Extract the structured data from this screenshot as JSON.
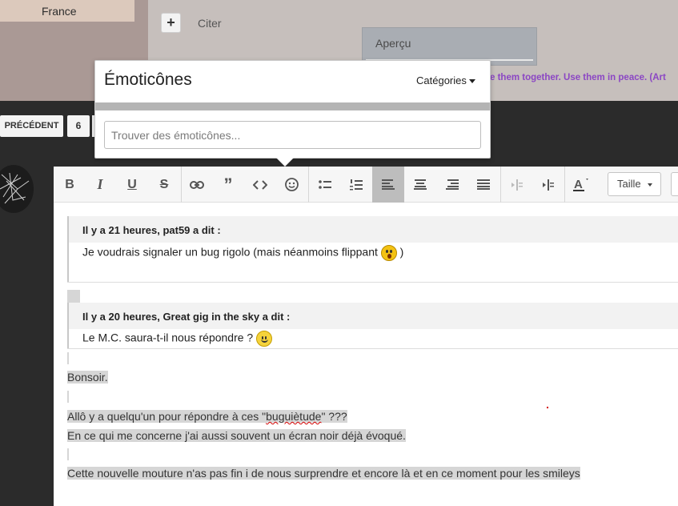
{
  "profile": {
    "location": "France"
  },
  "actions": {
    "add_label": "+",
    "quote_label": "Citer"
  },
  "signature_text": "e them together. Use them in peace.  (Art",
  "preview_menu": {
    "label": "Aperçu"
  },
  "pagination": {
    "prev_label": "PRÉCÉDENT",
    "page": "6"
  },
  "emoticons": {
    "title": "Émoticônes",
    "categories_label": "Catégories",
    "search_placeholder": "Trouver des émoticônes..."
  },
  "toolbar": {
    "bold": "B",
    "italic": "I",
    "underline": "U",
    "strike": "S",
    "size_label": "Taille"
  },
  "quotes": [
    {
      "author": "Il y a 21 heures, pat59 a dit :",
      "text": "Je voudrais signaler un bug rigolo (mais néanmoins flippant",
      "after": ")"
    },
    {
      "author": "Il y a 20 heures, Great gig in the sky a dit :",
      "text": "Le M.C. saura-t-il nous répondre ?"
    }
  ],
  "message": {
    "line1": "Bonsoir.",
    "line2_a": "Allô y a quelqu'un pour répondre à ces \"",
    "line2_b": "buguiètude",
    "line2_c": "\" ???",
    "line3": "En ce qui me concerne j'ai aussi souvent un écran noir déjà évoqué.",
    "line4": "Cette nouvelle mouture n'as pas fin i de nous surprendre et encore là et en ce moment pour les smileys"
  },
  "colors": {
    "accent_purple": "#8b46c4",
    "active_button": "#bdbdbd",
    "selection": "#d6d6d6"
  }
}
